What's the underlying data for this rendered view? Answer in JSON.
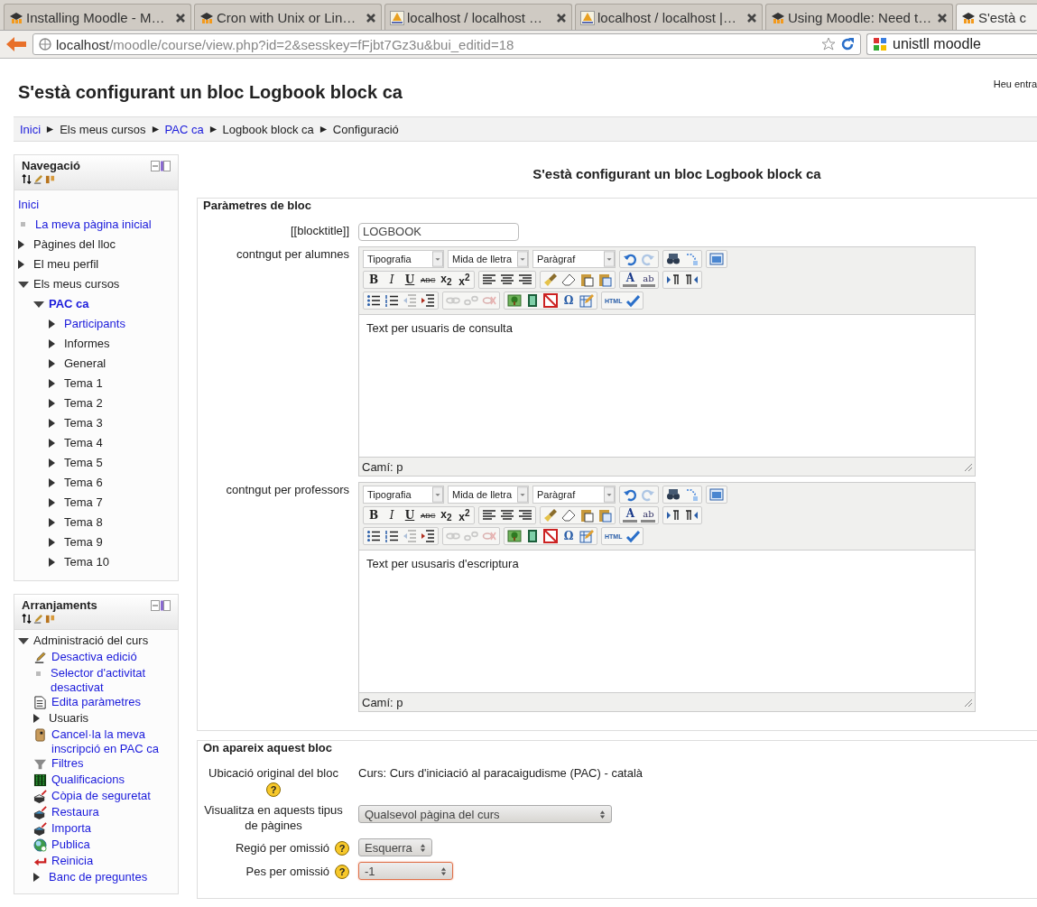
{
  "browser": {
    "tabs": [
      {
        "title": "Installing Moodle - M…",
        "kind": "moodle",
        "selected": false
      },
      {
        "title": "Cron with Unix or Lin…",
        "kind": "moodle",
        "selected": false
      },
      {
        "title": "localhost / localhost …",
        "kind": "pma",
        "selected": false
      },
      {
        "title": "localhost / localhost |…",
        "kind": "pma",
        "selected": false
      },
      {
        "title": "Using Moodle: Need t…",
        "kind": "moodle",
        "selected": false
      },
      {
        "title": "S'està c",
        "kind": "moodle",
        "selected": true
      }
    ],
    "address": {
      "host": "localhost",
      "path": "/moodle/course/view.php?id=2&sesskey=fFjbt7Gz3u&bui_editid=18"
    },
    "search": {
      "value": "unistll moodle"
    }
  },
  "header": {
    "title": "S'està configurant un bloc Logbook block ca",
    "login_info": "Heu entra"
  },
  "breadcrumb": [
    {
      "label": "Inici",
      "link": true
    },
    {
      "label": "Els meus cursos",
      "link": false
    },
    {
      "label": "PAC ca",
      "link": true
    },
    {
      "label": "Logbook block ca",
      "link": false
    },
    {
      "label": "Configuració",
      "link": false
    }
  ],
  "blocks": [
    {
      "title": "Navegació",
      "tree": [
        {
          "label": "Inici",
          "kind": "plain",
          "link": true,
          "current": false
        },
        {
          "label": "La meva pàgina inicial",
          "kind": "leaf",
          "link": true,
          "current": false
        },
        {
          "label": "Pàgines del lloc",
          "kind": "branch",
          "expanded": false,
          "link": false,
          "current": false
        },
        {
          "label": "El meu perfil",
          "kind": "branch",
          "expanded": false,
          "link": false,
          "current": false
        },
        {
          "label": "Els meus cursos",
          "kind": "branch",
          "expanded": true,
          "link": false,
          "current": false,
          "children": [
            {
              "label": "PAC ca",
              "kind": "branch",
              "expanded": true,
              "link": true,
              "current": true,
              "children": [
                {
                  "label": "Participants",
                  "kind": "branch",
                  "expanded": false,
                  "link": true,
                  "current": false
                },
                {
                  "label": "Informes",
                  "kind": "branch",
                  "expanded": false,
                  "link": false,
                  "current": false
                },
                {
                  "label": "General",
                  "kind": "branch",
                  "expanded": false,
                  "link": false,
                  "current": false
                },
                {
                  "label": "Tema 1",
                  "kind": "branch",
                  "expanded": false,
                  "link": false,
                  "current": false
                },
                {
                  "label": "Tema 2",
                  "kind": "branch",
                  "expanded": false,
                  "link": false,
                  "current": false
                },
                {
                  "label": "Tema 3",
                  "kind": "branch",
                  "expanded": false,
                  "link": false,
                  "current": false
                },
                {
                  "label": "Tema 4",
                  "kind": "branch",
                  "expanded": false,
                  "link": false,
                  "current": false
                },
                {
                  "label": "Tema 5",
                  "kind": "branch",
                  "expanded": false,
                  "link": false,
                  "current": false
                },
                {
                  "label": "Tema 6",
                  "kind": "branch",
                  "expanded": false,
                  "link": false,
                  "current": false
                },
                {
                  "label": "Tema 7",
                  "kind": "branch",
                  "expanded": false,
                  "link": false,
                  "current": false
                },
                {
                  "label": "Tema 8",
                  "kind": "branch",
                  "expanded": false,
                  "link": false,
                  "current": false
                },
                {
                  "label": "Tema 9",
                  "kind": "branch",
                  "expanded": false,
                  "link": false,
                  "current": false
                },
                {
                  "label": "Tema 10",
                  "kind": "branch",
                  "expanded": false,
                  "link": false,
                  "current": false
                }
              ]
            }
          ]
        }
      ]
    },
    {
      "title": "Arranjaments",
      "tree": [
        {
          "label": "Administració del curs",
          "kind": "branch",
          "expanded": true,
          "link": false,
          "current": false,
          "children": [
            {
              "label": "Desactiva edició",
              "kind": "edit",
              "link": true,
              "current": false
            },
            {
              "label": "Selector d'activitat desactivat",
              "kind": "leaf",
              "link": true,
              "current": false
            },
            {
              "label": "Edita paràmetres",
              "kind": "doc",
              "link": true,
              "current": false
            },
            {
              "label": "Usuaris",
              "kind": "branch",
              "expanded": false,
              "link": false,
              "current": false
            },
            {
              "label": "Cancel·la la meva inscripció en PAC ca",
              "kind": "person",
              "link": true,
              "current": false
            },
            {
              "label": "Filtres",
              "kind": "filter",
              "link": true,
              "current": false
            },
            {
              "label": "Qualificacions",
              "kind": "grades",
              "link": true,
              "current": false
            },
            {
              "label": "Còpia de seguretat",
              "kind": "backup",
              "link": true,
              "current": false
            },
            {
              "label": "Restaura",
              "kind": "restore",
              "link": true,
              "current": false
            },
            {
              "label": "Importa",
              "kind": "restore",
              "link": true,
              "current": false
            },
            {
              "label": "Publica",
              "kind": "publish",
              "link": true,
              "current": false
            },
            {
              "label": "Reinicia",
              "kind": "reset",
              "link": true,
              "current": false
            },
            {
              "label": "Banc de preguntes",
              "kind": "branch",
              "expanded": false,
              "link": true,
              "current": false
            }
          ]
        }
      ]
    }
  ],
  "main": {
    "heading": "S'està configurant un bloc Logbook block ca",
    "sections": [
      {
        "legend": "Paràmetres de bloc",
        "fields": [
          {
            "kind": "text",
            "label": "[[blocktitle]]",
            "value": "LOGBOOK"
          },
          {
            "kind": "editor",
            "label": "contngut per alumnes",
            "dropdowns": [
              "Tipografia",
              "Mida de lletra",
              "Paràgraf"
            ],
            "rows": [
              [
                [
                  {
                    "kind": "undo",
                    "disabled": false
                  },
                  {
                    "kind": "redo",
                    "disabled": true
                  }
                ],
                [
                  {
                    "kind": "find",
                    "disabled": false
                  },
                  {
                    "kind": "replace",
                    "disabled": false
                  }
                ],
                [
                  {
                    "kind": "fullscreen",
                    "disabled": false
                  }
                ]
              ],
              [
                [
                  {
                    "kind": "bold",
                    "label": "B",
                    "disabled": false
                  },
                  {
                    "kind": "italic",
                    "label": "I",
                    "disabled": false
                  },
                  {
                    "kind": "underline",
                    "label": "U",
                    "disabled": false
                  },
                  {
                    "kind": "strike",
                    "label": "ABC",
                    "disabled": false
                  },
                  {
                    "kind": "sub",
                    "label": "x$_{2}$",
                    "disabled": false
                  },
                  {
                    "kind": "sup",
                    "label": "x$^{2}$",
                    "disabled": false
                  }
                ],
                [
                  {
                    "kind": "alignleft",
                    "disabled": false
                  },
                  {
                    "kind": "aligncenter",
                    "disabled": false
                  },
                  {
                    "kind": "alignright",
                    "disabled": false
                  }
                ],
                [
                  {
                    "kind": "cleanup",
                    "disabled": false
                  },
                  {
                    "kind": "eraser",
                    "disabled": false
                  },
                  {
                    "kind": "pastetext",
                    "disabled": false
                  },
                  {
                    "kind": "pasteword",
                    "disabled": false
                  }
                ],
                [
                  {
                    "kind": "forecolor",
                    "label": "A",
                    "disabled": false
                  },
                  {
                    "kind": "hilite",
                    "label": "ab",
                    "disabled": false
                  }
                ],
                [
                  {
                    "kind": "ltr",
                    "disabled": false
                  },
                  {
                    "kind": "rtl",
                    "disabled": false
                  }
                ]
              ],
              [
                [
                  {
                    "kind": "bullets",
                    "disabled": false
                  },
                  {
                    "kind": "numbers",
                    "disabled": false
                  },
                  {
                    "kind": "outdent",
                    "disabled": true
                  },
                  {
                    "kind": "indent",
                    "disabled": false
                  }
                ],
                [
                  {
                    "kind": "link",
                    "disabled": true
                  },
                  {
                    "kind": "unlink",
                    "disabled": true
                  },
                  {
                    "kind": "anchor",
                    "disabled": true
                  }
                ],
                [
                  {
                    "kind": "image",
                    "disabled": false
                  },
                  {
                    "kind": "media",
                    "disabled": false
                  },
                  {
                    "kind": "nolink",
                    "disabled": false
                  },
                  {
                    "kind": "symbol",
                    "label": "Ω",
                    "disabled": false
                  },
                  {
                    "kind": "tableedit",
                    "disabled": false
                  }
                ],
                [
                  {
                    "kind": "html",
                    "label": "HTML",
                    "disabled": false
                  },
                  {
                    "kind": "spell",
                    "disabled": false
                  }
                ]
              ]
            ],
            "content": "Text per usuaris de consulta",
            "path": "Camí: p"
          },
          {
            "kind": "editor",
            "label": "contngut per professors",
            "dropdowns": [
              "Tipografia",
              "Mida de lletra",
              "Paràgraf"
            ],
            "rows": [
              [
                [
                  {
                    "kind": "undo",
                    "disabled": false
                  },
                  {
                    "kind": "redo",
                    "disabled": true
                  }
                ],
                [
                  {
                    "kind": "find",
                    "disabled": false
                  },
                  {
                    "kind": "replace",
                    "disabled": false
                  }
                ],
                [
                  {
                    "kind": "fullscreen",
                    "disabled": false
                  }
                ]
              ],
              [
                [
                  {
                    "kind": "bold",
                    "label": "B",
                    "disabled": false
                  },
                  {
                    "kind": "italic",
                    "label": "I",
                    "disabled": false
                  },
                  {
                    "kind": "underline",
                    "label": "U",
                    "disabled": false
                  },
                  {
                    "kind": "strike",
                    "label": "ABC",
                    "disabled": false
                  },
                  {
                    "kind": "sub",
                    "label": "x$_{2}$",
                    "disabled": false
                  },
                  {
                    "kind": "sup",
                    "label": "x$^{2}$",
                    "disabled": false
                  }
                ],
                [
                  {
                    "kind": "alignleft",
                    "disabled": false
                  },
                  {
                    "kind": "aligncenter",
                    "disabled": false
                  },
                  {
                    "kind": "alignright",
                    "disabled": false
                  }
                ],
                [
                  {
                    "kind": "cleanup",
                    "disabled": false
                  },
                  {
                    "kind": "eraser",
                    "disabled": false
                  },
                  {
                    "kind": "pastetext",
                    "disabled": false
                  },
                  {
                    "kind": "pasteword",
                    "disabled": false
                  }
                ],
                [
                  {
                    "kind": "forecolor",
                    "label": "A",
                    "disabled": false
                  },
                  {
                    "kind": "hilite",
                    "label": "ab",
                    "disabled": false
                  }
                ],
                [
                  {
                    "kind": "ltr",
                    "disabled": false
                  },
                  {
                    "kind": "rtl",
                    "disabled": false
                  }
                ]
              ],
              [
                [
                  {
                    "kind": "bullets",
                    "disabled": false
                  },
                  {
                    "kind": "numbers",
                    "disabled": false
                  },
                  {
                    "kind": "outdent",
                    "disabled": true
                  },
                  {
                    "kind": "indent",
                    "disabled": false
                  }
                ],
                [
                  {
                    "kind": "link",
                    "disabled": true
                  },
                  {
                    "kind": "unlink",
                    "disabled": true
                  },
                  {
                    "kind": "anchor",
                    "disabled": true
                  }
                ],
                [
                  {
                    "kind": "image",
                    "disabled": false
                  },
                  {
                    "kind": "media",
                    "disabled": false
                  },
                  {
                    "kind": "nolink",
                    "disabled": false
                  },
                  {
                    "kind": "symbol",
                    "label": "Ω",
                    "disabled": false
                  },
                  {
                    "kind": "tableedit",
                    "disabled": false
                  }
                ],
                [
                  {
                    "kind": "html",
                    "label": "HTML",
                    "disabled": false
                  },
                  {
                    "kind": "spell",
                    "disabled": false
                  }
                ]
              ]
            ],
            "content": "Text per ususaris d'escriptura",
            "path": "Camí: p"
          }
        ]
      },
      {
        "legend": "On apareix aquest bloc",
        "fields": [
          {
            "kind": "static",
            "label": "Ubicació original del bloc",
            "help": "?",
            "value": "Curs: Curs d'iniciació al paracaigudisme (PAC) - català"
          },
          {
            "kind": "select",
            "label": "Visualitza en aquests tipus de pàgines",
            "value": "Qualsevol pàgina del curs",
            "focused": false
          },
          {
            "kind": "select",
            "label": "Regió per omissió",
            "help": "?",
            "value": "Esquerra",
            "focused": false
          },
          {
            "kind": "select",
            "label": "Pes per omissió",
            "help": "?",
            "value": "-1",
            "focused": true
          }
        ]
      }
    ]
  }
}
